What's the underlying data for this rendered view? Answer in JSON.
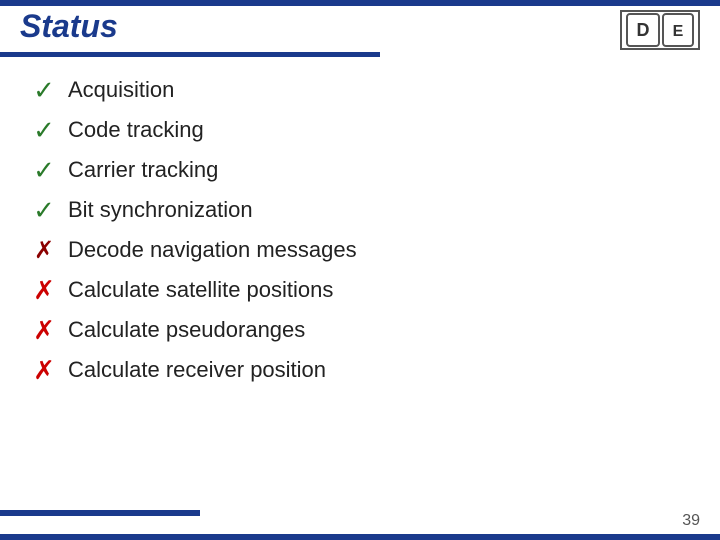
{
  "slide": {
    "title": "Status",
    "title_underline_visible": true,
    "logo_text": "D|E",
    "page_number": "39"
  },
  "list": {
    "items": [
      {
        "id": 1,
        "label": "Acquisition",
        "status": "check",
        "icon_type": "green-check",
        "icon_char": "✓"
      },
      {
        "id": 2,
        "label": "Code tracking",
        "status": "check",
        "icon_type": "green-check",
        "icon_char": "✓"
      },
      {
        "id": 3,
        "label": "Carrier tracking",
        "status": "check",
        "icon_type": "green-check",
        "icon_char": "✓"
      },
      {
        "id": 4,
        "label": "Bit synchronization",
        "status": "check",
        "icon_type": "green-check",
        "icon_char": "✓"
      },
      {
        "id": 5,
        "label": "Decode navigation messages",
        "status": "partial",
        "icon_type": "partial-check",
        "icon_char": "✗"
      },
      {
        "id": 6,
        "label": "Calculate satellite positions",
        "status": "cross",
        "icon_type": "red-cross",
        "icon_char": "✗"
      },
      {
        "id": 7,
        "label": "Calculate pseudoranges",
        "status": "cross",
        "icon_type": "red-cross",
        "icon_char": "✗"
      },
      {
        "id": 8,
        "label": "Calculate receiver position",
        "status": "cross",
        "icon_type": "red-cross",
        "icon_char": "✗"
      }
    ]
  },
  "colors": {
    "blue": "#1a3a8c",
    "green": "#2a7a2a",
    "dark_red": "#8b0000",
    "red": "#cc0000"
  }
}
